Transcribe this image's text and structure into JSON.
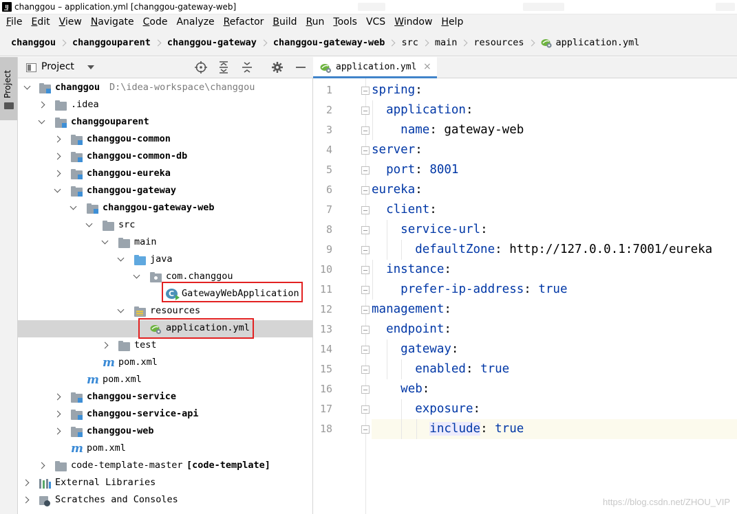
{
  "window": {
    "title": "changgou – application.yml [changgou-gateway-web]",
    "app_icon_label": "IJ"
  },
  "menu": [
    {
      "mnemonic": "F",
      "rest": "ile"
    },
    {
      "mnemonic": "E",
      "rest": "dit"
    },
    {
      "mnemonic": "V",
      "rest": "iew"
    },
    {
      "mnemonic": "N",
      "rest": "avigate"
    },
    {
      "mnemonic": "C",
      "rest": "ode"
    },
    {
      "mnemonic": "",
      "rest": "Analyze"
    },
    {
      "mnemonic": "R",
      "rest": "efactor"
    },
    {
      "mnemonic": "B",
      "rest": "uild"
    },
    {
      "mnemonic": "R",
      "rest": "un"
    },
    {
      "mnemonic": "T",
      "rest": "ools"
    },
    {
      "mnemonic": "",
      "rest": "VCS"
    },
    {
      "mnemonic": "W",
      "rest": "indow"
    },
    {
      "mnemonic": "H",
      "rest": "elp"
    }
  ],
  "breadcrumb": [
    "changgou",
    "changgouparent",
    "changgou-gateway",
    "changgou-gateway-web",
    "src",
    "main",
    "resources",
    "application.yml"
  ],
  "tool_window": {
    "stripe_label": "Project",
    "title": "Project",
    "icons": [
      "locate-icon",
      "expand-all-icon",
      "collapse-all-icon",
      "settings-icon",
      "minimize-icon"
    ]
  },
  "tree": [
    {
      "label": "changgou",
      "path": "D:\\idea-workspace\\changgou",
      "bold": true
    },
    {
      "label": ".idea"
    },
    {
      "label": "changgouparent",
      "bold": true
    },
    {
      "label": "changgou-common",
      "bold": true
    },
    {
      "label": "changgou-common-db",
      "bold": true
    },
    {
      "label": "changgou-eureka",
      "bold": true
    },
    {
      "label": "changgou-gateway",
      "bold": true
    },
    {
      "label": "changgou-gateway-web",
      "bold": true
    },
    {
      "label": "src"
    },
    {
      "label": "main"
    },
    {
      "label": "java"
    },
    {
      "label": "com.changgou"
    },
    {
      "label": "GatewayWebApplication"
    },
    {
      "label": "resources"
    },
    {
      "label": "application.yml"
    },
    {
      "label": "test"
    },
    {
      "label": "pom.xml"
    },
    {
      "label": "pom.xml"
    },
    {
      "label": "changgou-service",
      "bold": true
    },
    {
      "label": "changgou-service-api",
      "bold": true
    },
    {
      "label": "changgou-web",
      "bold": true
    },
    {
      "label": "pom.xml"
    },
    {
      "label": "code-template-master",
      "suffix": "[code-template]"
    },
    {
      "label": "External Libraries"
    },
    {
      "label": "Scratches and Consoles"
    }
  ],
  "editor": {
    "tab_label": "application.yml",
    "close_glyph": "×",
    "line_numbers": [
      "1",
      "2",
      "3",
      "4",
      "5",
      "6",
      "7",
      "8",
      "9",
      "10",
      "11",
      "12",
      "13",
      "14",
      "15",
      "16",
      "17",
      "18"
    ],
    "lines": [
      {
        "key": "spring",
        "sep": ":",
        "val": ""
      },
      {
        "key": "application",
        "sep": ":",
        "val": ""
      },
      {
        "key": "name",
        "sep": ":",
        "val": " gateway-web"
      },
      {
        "key": "server",
        "sep": ":",
        "val": ""
      },
      {
        "key": "port",
        "sep": ":",
        "val": " 8001"
      },
      {
        "key": "eureka",
        "sep": ":",
        "val": ""
      },
      {
        "key": "client",
        "sep": ":",
        "val": ""
      },
      {
        "key": "service-url",
        "sep": ":",
        "val": ""
      },
      {
        "key": "defaultZone",
        "sep": ":",
        "val": " http://127.0.0.1:7001/eureka"
      },
      {
        "key": "instance",
        "sep": ":",
        "val": ""
      },
      {
        "key": "prefer-ip-address",
        "sep": ":",
        "val": " true"
      },
      {
        "key": "management",
        "sep": ":",
        "val": ""
      },
      {
        "key": "endpoint",
        "sep": ":",
        "val": ""
      },
      {
        "key": "gateway",
        "sep": ":",
        "val": ""
      },
      {
        "key": "enabled",
        "sep": ":",
        "val": " true"
      },
      {
        "key": "web",
        "sep": ":",
        "val": ""
      },
      {
        "key": "exposure",
        "sep": ":",
        "val": ""
      },
      {
        "key": "include",
        "sep": ":",
        "val": " true"
      }
    ]
  },
  "watermark": "https://blog.csdn.net/ZHOU_VIP",
  "colors": {
    "yaml_key": "#0037a6",
    "selection": "#d5d5d5",
    "highlight_box": "#e22121",
    "tab_underline": "#4083c9"
  }
}
